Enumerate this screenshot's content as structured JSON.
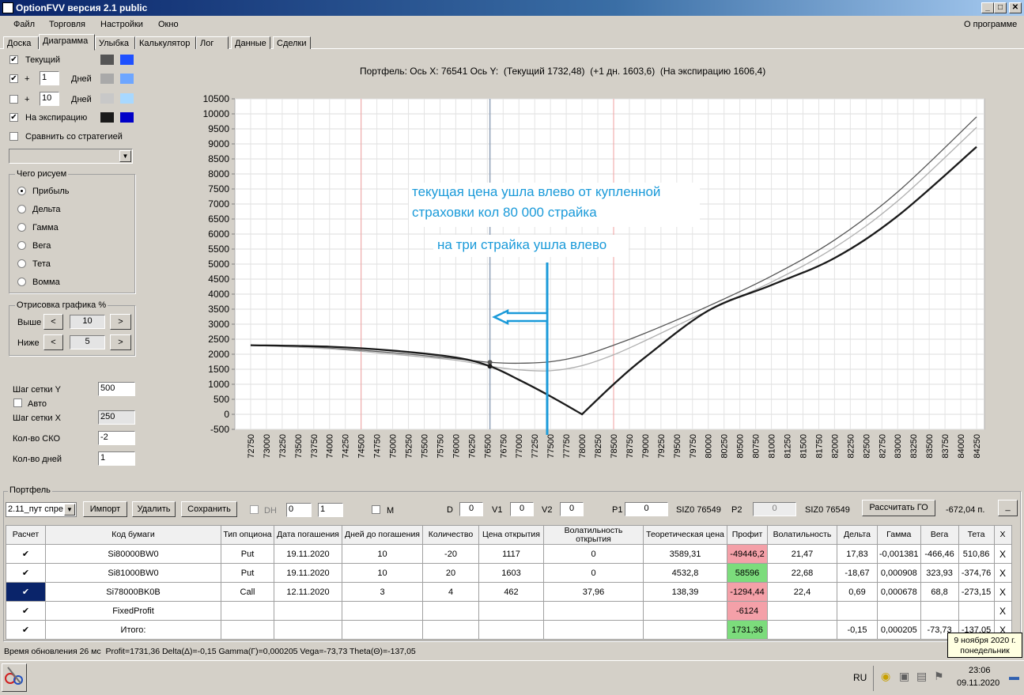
{
  "window": {
    "title": "OptionFVV версия 2.1 public",
    "min": "_",
    "max": "□",
    "close": "✕"
  },
  "menu": [
    "Файл",
    "Торговля",
    "Настройки",
    "Окно"
  ],
  "menu_about": "О программе",
  "tabs": [
    "Доска",
    "Диаграмма",
    "Улыбка",
    "Калькулятор",
    "Лог",
    "Данные",
    "Сделки"
  ],
  "left": {
    "current": "Текущий",
    "plus": "+",
    "days_label": "Дней",
    "days1": "1",
    "days2": "10",
    "expiry": "На экспирацию",
    "compare": "Сравнить со стратегией",
    "what_group": "Чего рисуем",
    "radios": [
      "Прибыль",
      "Дельта",
      "Гамма",
      "Вега",
      "Тета",
      "Вомма"
    ],
    "draw_group": "Отрисовка графика %",
    "above": "Выше",
    "below": "Ниже",
    "above_val": "10",
    "below_val": "5",
    "left_arrow": "<",
    "right_arrow": ">",
    "gridY_label": "Шаг сетки Y",
    "gridY": "500",
    "auto": "Авто",
    "gridX_label": "Шаг сетки X",
    "gridX": "250",
    "sko_label": "Кол-во СКО",
    "sko": "-2",
    "ndays_label": "Кол-во дней",
    "ndays": "1"
  },
  "chart_header": "Портфель: Ось X: 76541 Ось Y:  (Текущий 1732,48)  (+1 дн. 1603,6)  (На экспирацию 1606,4)",
  "annotations": {
    "line1": "текущая цена ушла влево от купленной",
    "line2": "страховки кол 80 000 страйка",
    "line3": "на три страйка ушла влево"
  },
  "chart_data": {
    "type": "line",
    "ylim": [
      -500,
      10500
    ],
    "xlim": [
      72500,
      84375
    ],
    "yticks": [
      -500,
      0,
      500,
      1000,
      1500,
      2000,
      2500,
      3000,
      3500,
      4000,
      4500,
      5000,
      5500,
      6000,
      6500,
      7000,
      7500,
      8000,
      8500,
      9000,
      9500,
      10000,
      10500
    ],
    "xticks": [
      72750,
      73000,
      73250,
      73500,
      73750,
      74000,
      74250,
      74500,
      74750,
      75000,
      75250,
      75500,
      75750,
      76000,
      76250,
      76500,
      76750,
      77000,
      77250,
      77500,
      77750,
      78000,
      78250,
      78500,
      78750,
      79000,
      79250,
      79500,
      79750,
      80000,
      80250,
      80500,
      80750,
      81000,
      81250,
      81500,
      81750,
      82000,
      82250,
      82500,
      82750,
      83000,
      83250,
      83500,
      83750,
      84000,
      84250
    ],
    "vlines": {
      "current": 76541,
      "sigma_low": 74500,
      "sigma_high": 78500
    },
    "series": [
      {
        "x": [
          72750,
          74000,
          75000,
          76000,
          76541,
          77000,
          77500,
          78000,
          78500,
          79000,
          80000,
          81000,
          82000,
          83000,
          84250
        ],
        "y": [
          2300,
          2200,
          2050,
          1850,
          1730,
          1700,
          1750,
          1950,
          2300,
          2700,
          3600,
          4600,
          5800,
          7400,
          9900
        ]
      },
      {
        "x": [
          72750,
          74000,
          75000,
          76000,
          76541,
          77000,
          77500,
          78000,
          78500,
          79000,
          80000,
          81000,
          82000,
          83000,
          84250
        ],
        "y": [
          2300,
          2180,
          2000,
          1800,
          1600,
          1480,
          1450,
          1620,
          1980,
          2450,
          3450,
          4400,
          5550,
          7100,
          9550
        ]
      },
      {
        "x": [
          72750,
          74000,
          75000,
          76000,
          76541,
          77000,
          77500,
          78000,
          78500,
          79000,
          80000,
          81000,
          82000,
          83000,
          84250
        ],
        "y": [
          2300,
          2250,
          2120,
          1890,
          1600,
          1150,
          600,
          0,
          1000,
          1900,
          3450,
          4300,
          5200,
          6600,
          8900
        ]
      }
    ],
    "colors": [
      "#555555",
      "#b0b0b0",
      "#1a1a1a"
    ]
  },
  "portfolio": {
    "label": "Портфель",
    "combo": "2.11_пут спре",
    "import": "Импорт",
    "delete": "Удалить",
    "save": "Сохранить",
    "dh": "DH",
    "spin1": "0",
    "spin2": "1",
    "m": "M",
    "d_label": "D",
    "d": "0",
    "v1_label": "V1",
    "v1": "0",
    "v2_label": "V2",
    "v2": "0",
    "p1_label": "P1",
    "p1": "0",
    "siz1": "SIZ0 76549",
    "p2_label": "P2",
    "p2": "0",
    "siz2": "SIZ0 76549",
    "calc_go": "Рассчитать ГО",
    "go_value": "-672,04 п.",
    "minimize": "_"
  },
  "table": {
    "headers": [
      "Расчет",
      "Код бумаги",
      "Тип опциона",
      "Дата погашения",
      "Дней до погашения",
      "Количество",
      "Цена открытия",
      "Волатильность открытия",
      "Теоретическая цена",
      "Профит",
      "Волатильность",
      "Дельта",
      "Гамма",
      "Вега",
      "Тета",
      "X"
    ],
    "rows": [
      [
        "✔",
        "Si80000BW0",
        "Put",
        "19.11.2020",
        "10",
        "-20",
        "1117",
        "0",
        "3589,31",
        "-49446,2",
        "21,47",
        "17,83",
        "-0,001381",
        "-466,46",
        "510,86",
        "X"
      ],
      [
        "✔",
        "Si81000BW0",
        "Put",
        "19.11.2020",
        "10",
        "20",
        "1603",
        "0",
        "4532,8",
        "58596",
        "22,68",
        "-18,67",
        "0,000908",
        "323,93",
        "-374,76",
        "X"
      ],
      [
        "✔",
        "Si78000BK0B",
        "Call",
        "12.11.2020",
        "3",
        "4",
        "462",
        "37,96",
        "138,39",
        "-1294,44",
        "22,4",
        "0,69",
        "0,000678",
        "68,8",
        "-273,15",
        "X"
      ],
      [
        "✔",
        "FixedProfit",
        "",
        "",
        "",
        "",
        "",
        "",
        "",
        "-6124",
        "",
        "",
        "",
        "",
        "",
        "X"
      ],
      [
        "✔",
        "Итого:",
        "",
        "",
        "",
        "",
        "",
        "",
        "",
        "1731,36",
        "",
        "-0,15",
        "0,000205",
        "-73,73",
        "-137,05",
        "X"
      ]
    ],
    "profit_colors": [
      "#f4a0a8",
      "#7cdc7c",
      "#f4a0a8",
      "#f4a0a8",
      "#7cdc7c"
    ]
  },
  "status": "Время обновления 26 мс  Profit=1731,36 Delta(Δ)=-0,15 Gamma(Γ)=0,000205 Vega=-73,73 Theta(Θ)=-137,05",
  "tooltip": {
    "line1": "9 ноября 2020 г.",
    "line2": "понедельник"
  },
  "taskbar": {
    "lang": "RU",
    "time": "23:06",
    "date": "09.11.2020"
  }
}
